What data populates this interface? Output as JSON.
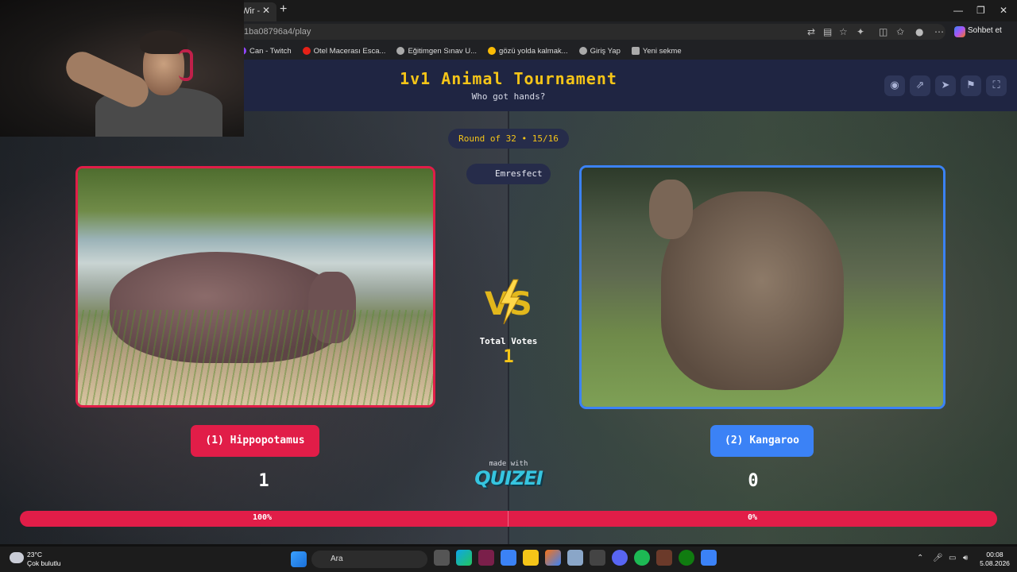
{
  "browser": {
    "tab_title": "Wir - ",
    "address": "1ba08796a4/play",
    "chat_button": "Sohbet et",
    "bookmarks": [
      {
        "label": "Can - Twitch",
        "color": "#9146ff"
      },
      {
        "label": "Otel Macerası Esca...",
        "color": "#e62117"
      },
      {
        "label": "Eğitimgen Sınav U...",
        "color": "#aaaaaa"
      },
      {
        "label": "gözü yolda kalmak...",
        "color": "#fbbc05"
      },
      {
        "label": "Giriş Yap",
        "color": "#aaaaaa"
      },
      {
        "label": "Yeni sekme",
        "color": "#aaaaaa"
      }
    ]
  },
  "header": {
    "title": "1v1 Animal Tournament",
    "subtitle": "Who got hands?"
  },
  "round_label": "Round of 32 • 15/16",
  "user": {
    "name": "Emresfect"
  },
  "center": {
    "total_votes_label": "Total Votes",
    "total_votes": "1",
    "made_with": "made with",
    "brand": "QUIZEI"
  },
  "left": {
    "label": "(1) Hippopotamus",
    "votes": "1",
    "percent": "100%",
    "fraction": 1.0,
    "color": "#e11d48"
  },
  "right": {
    "label": "(2) Kangaroo",
    "votes": "0",
    "percent": "0%",
    "fraction": 0.0,
    "color": "#3b82f6"
  },
  "taskbar": {
    "temperature": "23°C",
    "weather": "Çok bulutlu",
    "search_placeholder": "Ara",
    "time": "00:08",
    "date": "5.08.2026"
  }
}
